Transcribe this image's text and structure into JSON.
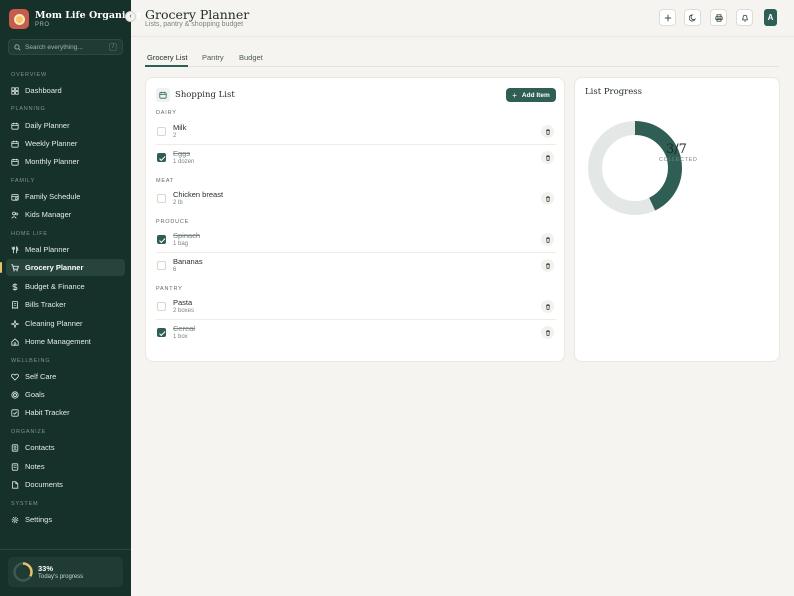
{
  "app": {
    "name": "Mom Life Organizer",
    "tier": "PRO"
  },
  "search": {
    "placeholder": "Search everything...",
    "shortcut": "/"
  },
  "sidebar": {
    "sections": [
      {
        "label": "OVERVIEW"
      },
      {
        "label": "PLANNING"
      },
      {
        "label": "FAMILY"
      },
      {
        "label": "HOME LIFE"
      },
      {
        "label": "WELLBEING"
      },
      {
        "label": "ORGANIZE"
      },
      {
        "label": "SYSTEM"
      }
    ],
    "items": [
      {
        "label": "Dashboard",
        "icon": "grid-icon"
      },
      {
        "label": "Daily Planner",
        "icon": "calendar-icon"
      },
      {
        "label": "Weekly Planner",
        "icon": "calendar-icon"
      },
      {
        "label": "Monthly Planner",
        "icon": "calendar-icon"
      },
      {
        "label": "Family Schedule",
        "icon": "calendar-clock-icon"
      },
      {
        "label": "Kids Manager",
        "icon": "users-icon"
      },
      {
        "label": "Meal Planner",
        "icon": "utensils-icon"
      },
      {
        "label": "Grocery Planner",
        "icon": "cart-icon",
        "active": true
      },
      {
        "label": "Budget & Finance",
        "icon": "dollar-icon"
      },
      {
        "label": "Bills Tracker",
        "icon": "receipt-icon"
      },
      {
        "label": "Cleaning Planner",
        "icon": "sparkle-icon"
      },
      {
        "label": "Home Management",
        "icon": "home-icon"
      },
      {
        "label": "Self Care",
        "icon": "heart-icon"
      },
      {
        "label": "Goals",
        "icon": "target-icon"
      },
      {
        "label": "Habit Tracker",
        "icon": "check-square-icon"
      },
      {
        "label": "Contacts",
        "icon": "address-book-icon"
      },
      {
        "label": "Notes",
        "icon": "note-icon"
      },
      {
        "label": "Documents",
        "icon": "document-icon"
      },
      {
        "label": "Settings",
        "icon": "gear-icon"
      }
    ]
  },
  "daily_progress": {
    "value": "33%",
    "label": "Today's progress",
    "fraction": 0.33,
    "accent": "#e8c06a"
  },
  "header": {
    "title": "Grocery Planner",
    "subtitle": "Lists, pantry & shopping budget",
    "avatar_initial": "A",
    "icons": [
      "plus-icon",
      "moon-icon",
      "print-icon",
      "bell-icon"
    ]
  },
  "tabs": [
    {
      "label": "Grocery List",
      "active": true
    },
    {
      "label": "Pantry"
    },
    {
      "label": "Budget"
    }
  ],
  "shopping": {
    "title": "Shopping List",
    "add_label": "Add Item",
    "categories": [
      {
        "label": "DAIRY",
        "items": [
          {
            "name": "Milk",
            "qty": "2",
            "checked": false
          },
          {
            "name": "Eggs",
            "qty": "1 dozen",
            "checked": true
          }
        ]
      },
      {
        "label": "MEAT",
        "items": [
          {
            "name": "Chicken breast",
            "qty": "2 lb",
            "checked": false
          }
        ]
      },
      {
        "label": "PRODUCE",
        "items": [
          {
            "name": "Spinach",
            "qty": "1 bag",
            "checked": true
          },
          {
            "name": "Bananas",
            "qty": "6",
            "checked": false
          }
        ]
      },
      {
        "label": "PANTRY",
        "items": [
          {
            "name": "Pasta",
            "qty": "2 boxes",
            "checked": false
          },
          {
            "name": "Cereal",
            "qty": "1 box",
            "checked": true
          }
        ]
      }
    ]
  },
  "progress": {
    "title": "List Progress",
    "count": "3/7",
    "label": "COLLECTED",
    "fraction": 0.4286,
    "color_done": "#2f5e55",
    "color_track": "#e3e8e6"
  }
}
